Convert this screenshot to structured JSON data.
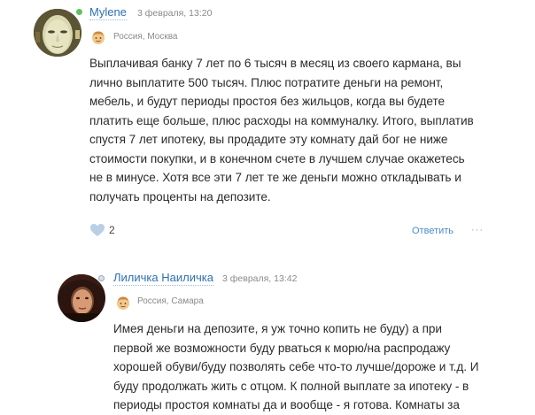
{
  "comments": [
    {
      "author": "Mylene",
      "date": "3 февраля, 13:20",
      "location": "Россия, Москва",
      "avatar_icon": "face-mask-avatar",
      "online": true,
      "text_lines": [
        "Выплачивая банку 7 лет по 6 тысяч в месяц из своего кармана, вы",
        "лично выплатите 500 тысяч. Плюс потратите деньги на ремонт,",
        "мебель, и будут периоды простоя без жильцов, когда вы будете",
        "платить еще больше, плюс расходы на коммуналку. Итого, выплатив",
        "спустя 7 лет ипотеку, вы продадите эту комнату дай бог не ниже",
        "стоимости покупки, и в конечном счете в лучшем случае окажетесь",
        "не в минусе. Хотя все эти 7 лет те же деньги можно откладывать и",
        "получать проценты на депозите."
      ],
      "likes": "2",
      "reply_label": "Ответить",
      "more_label": "···"
    },
    {
      "author": "Лиличка Наиличка",
      "date": "3 февраля, 13:42",
      "location": "Россия, Самара",
      "avatar_icon": "girl-photo-avatar",
      "online": false,
      "text_lines": [
        "Имея деньги на депозите, я уж точно копить не буду) а при",
        "первой же возможности буду рваться к морю/на распродажу",
        "хорошей обуви/буду позволять себе что-то лучше/дороже и т.д. И",
        "буду продолжать жить с отцом. К полной выплате за ипотеку - в",
        "периоды простоя комнаты да и вообще - я готова. Комнаты за"
      ]
    }
  ],
  "colors": {
    "link": "#2f6fb3",
    "online": "#5cc25c",
    "like_heart": "#b9cfe6",
    "reply": "#4a8bd0"
  }
}
